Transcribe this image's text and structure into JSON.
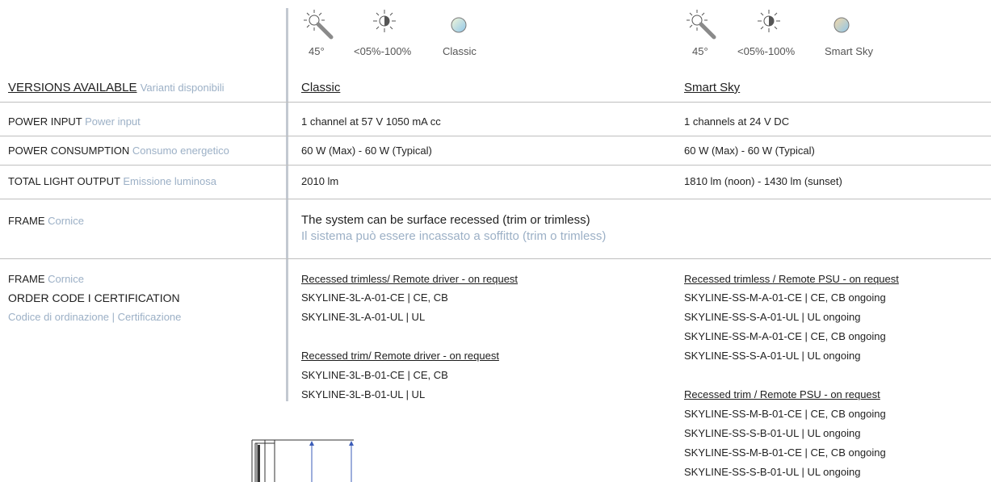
{
  "icons": {
    "classic": [
      {
        "icon": "sun-beam-angle-icon",
        "caption": "45°"
      },
      {
        "icon": "sun-dimming-icon",
        "caption": "<05%-100%"
      },
      {
        "icon": "classic-sky-icon",
        "caption": "Classic"
      }
    ],
    "smart": [
      {
        "icon": "sun-beam-angle-icon",
        "caption": "45°"
      },
      {
        "icon": "sun-dimming-icon",
        "caption": "<05%-100%"
      },
      {
        "icon": "smart-sky-icon",
        "caption": "Smart Sky"
      }
    ]
  },
  "versions": {
    "label": "VERSIONS AVAILABLE",
    "label_it": "Varianti disponibili",
    "classic": "Classic",
    "smart": "Smart Sky"
  },
  "rows": [
    {
      "label": "POWER INPUT",
      "label_it": "Power input",
      "classic": "1 channel at 57 V 1050 mA cc",
      "smart": "1 channels at 24 V DC"
    },
    {
      "label": "POWER CONSUMPTION",
      "label_it": "Consumo energetico",
      "classic": "60 W (Max) - 60 W (Typical)",
      "smart": "60 W (Max) - 60 W (Typical)"
    },
    {
      "label": "TOTAL LIGHT OUTPUT",
      "label_it": "Emissione luminosa",
      "classic": "2010 lm",
      "smart": "1810 lm (noon) - 1430 lm (sunset)"
    }
  ],
  "frame": {
    "label": "FRAME",
    "label_it": "Cornice",
    "text": "The system can be surface recessed (trim or trimless)",
    "text_it": "Il sistema può essere incassato a soffitto (trim o trimless)"
  },
  "order": {
    "label1": "FRAME",
    "label1_it": "Cornice",
    "label2": "ORDER CODE  I  CERTIFICATION",
    "label3_it": "Codice di ordinazione  |  Certificazione",
    "classic_trimless_title": "Recessed trimless/ Remote driver - on request",
    "classic_trimless": [
      "SKYLINE-3L-A-01-CE   |   CE, CB",
      "SKYLINE-3L-A-01-UL   |   UL"
    ],
    "classic_trim_title": "Recessed trim/ Remote driver - on request",
    "classic_trim": [
      "SKYLINE-3L-B-01-CE   |   CE, CB",
      "SKYLINE-3L-B-01-UL   |   UL"
    ],
    "smart_trimless_title": "Recessed trimless / Remote PSU - on request",
    "smart_trimless": [
      "SKYLINE-SS-M-A-01-CE   |   CE, CB ongoing",
      "SKYLINE-SS-S-A-01-UL   |   UL ongoing",
      "SKYLINE-SS-M-A-01-CE   |   CE, CB ongoing",
      "SKYLINE-SS-S-A-01-UL   |   UL ongoing"
    ],
    "smart_trim_title": "Recessed trim / Remote PSU - on request",
    "smart_trim": [
      "SKYLINE-SS-M-B-01-CE   |   CE, CB ongoing",
      "SKYLINE-SS-S-B-01-UL   |   UL ongoing",
      "SKYLINE-SS-M-B-01-CE   |   CE, CB ongoing",
      "SKYLINE-SS-S-B-01-UL   |   UL ongoing"
    ]
  },
  "colors": {
    "accent_italic": "#9cb0c6",
    "rule": "#bfbfbf",
    "divider": "#c3c9d1"
  }
}
